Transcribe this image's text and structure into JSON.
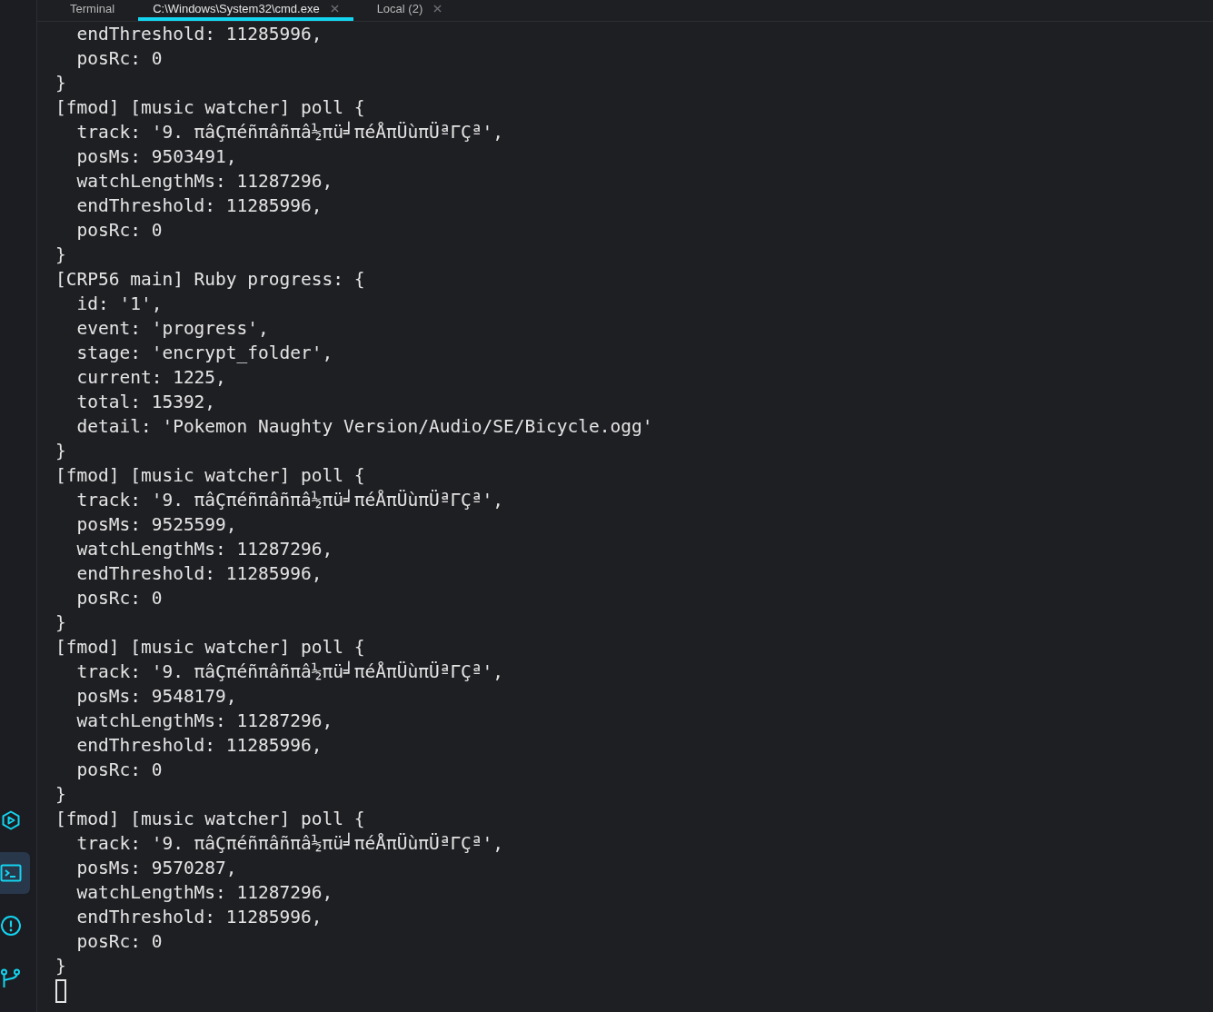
{
  "tabs": [
    {
      "label": "Terminal",
      "selected": false,
      "closable": false
    },
    {
      "label": "C:\\Windows\\System32\\cmd.exe",
      "selected": true,
      "closable": true
    },
    {
      "label": "Local (2)",
      "selected": false,
      "closable": true
    }
  ],
  "activity_bar": [
    {
      "kind": "run",
      "selected": false
    },
    {
      "kind": "terminal",
      "selected": true
    },
    {
      "kind": "problems",
      "selected": false
    },
    {
      "kind": "source-control",
      "selected": false
    }
  ],
  "terminal_lines": [
    "  endThreshold: 11285996,",
    "  posRc: 0",
    "}",
    "[fmod] [music watcher] poll {",
    "  track: '9. πâÇπéñπâñπâ½πü╛πéÅπÜùπÜªΓÇª',",
    "  posMs: 9503491,",
    "  watchLengthMs: 11287296,",
    "  endThreshold: 11285996,",
    "  posRc: 0",
    "}",
    "[CRP56 main] Ruby progress: {",
    "  id: '1',",
    "  event: 'progress',",
    "  stage: 'encrypt_folder',",
    "  current: 1225,",
    "  total: 15392,",
    "  detail: 'Pokemon Naughty Version/Audio/SE/Bicycle.ogg'",
    "}",
    "[fmod] [music watcher] poll {",
    "  track: '9. πâÇπéñπâñπâ½πü╛πéÅπÜùπÜªΓÇª',",
    "  posMs: 9525599,",
    "  watchLengthMs: 11287296,",
    "  endThreshold: 11285996,",
    "  posRc: 0",
    "}",
    "[fmod] [music watcher] poll {",
    "  track: '9. πâÇπéñπâñπâ½πü╛πéÅπÜùπÜªΓÇª',",
    "  posMs: 9548179,",
    "  watchLengthMs: 11287296,",
    "  endThreshold: 11285996,",
    "  posRc: 0",
    "}",
    "[fmod] [music watcher] poll {",
    "  track: '9. πâÇπéñπâñπâ½πü╛πéÅπÜùπÜªΓÇª',",
    "  posMs: 9570287,",
    "  watchLengthMs: 11287296,",
    "  endThreshold: 11285996,",
    "  posRc: 0",
    "}"
  ],
  "cursor": true
}
